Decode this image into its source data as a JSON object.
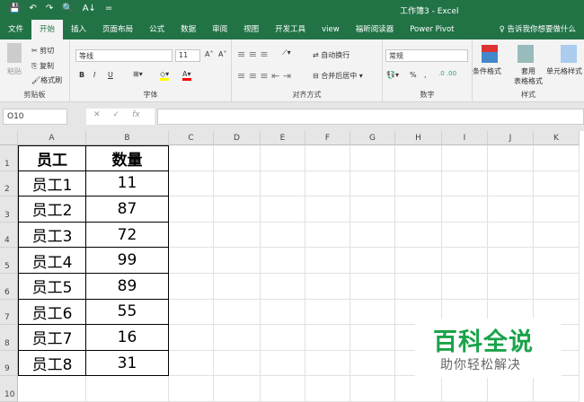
{
  "title_bar": {
    "quick_access": [
      "💾",
      "↶",
      "↷",
      "🔍",
      "A↓",
      "="
    ],
    "title": "工作簿3  -  Excel"
  },
  "tabs": [
    {
      "label": "文件"
    },
    {
      "label": "开始",
      "active": true
    },
    {
      "label": "插入"
    },
    {
      "label": "页面布局"
    },
    {
      "label": "公式"
    },
    {
      "label": "数据"
    },
    {
      "label": "审阅"
    },
    {
      "label": "视图"
    },
    {
      "label": "开发工具"
    },
    {
      "label": "view"
    },
    {
      "label": "福昕阅读器"
    },
    {
      "label": "Power Pivot"
    },
    {
      "label": "♀ 告诉我你想要做什么"
    }
  ],
  "ribbon": {
    "clipboard": {
      "paste": "粘贴",
      "cut": "剪切",
      "copy": "复制",
      "format_painter": "格式刷",
      "label": "剪贴板"
    },
    "font": {
      "name": "等线",
      "size": "11",
      "bold": "B",
      "italic": "I",
      "underline": "U",
      "grow": "A˄",
      "shrink": "A˅",
      "label": "字体"
    },
    "alignment": {
      "wrap": "自动换行",
      "merge": "合并后居中",
      "label": "对齐方式"
    },
    "number": {
      "format": "常规",
      "percent": "%",
      "comma": ",",
      "label": "数字"
    },
    "styles": {
      "conditional": "条件格式",
      "table": "套用\n表格格式",
      "cell": "单元格样式",
      "label": "样式"
    }
  },
  "formula_bar": {
    "name_box": "O10",
    "value": "",
    "fx": "fx"
  },
  "columns": [
    "A",
    "B",
    "C",
    "D",
    "E",
    "F",
    "G",
    "H",
    "I",
    "J",
    "K"
  ],
  "rows": [
    "1",
    "2",
    "3",
    "4",
    "5",
    "6",
    "7",
    "8",
    "9",
    "10"
  ],
  "table": {
    "headers": [
      "员工",
      "数量"
    ],
    "rows": [
      [
        "员工1",
        "11"
      ],
      [
        "员工2",
        "87"
      ],
      [
        "员工3",
        "72"
      ],
      [
        "员工4",
        "99"
      ],
      [
        "员工5",
        "89"
      ],
      [
        "员工6",
        "55"
      ],
      [
        "员工7",
        "16"
      ],
      [
        "员工8",
        "31"
      ]
    ]
  },
  "watermark": {
    "title": "百科全说",
    "subtitle": "助你轻松解决"
  }
}
